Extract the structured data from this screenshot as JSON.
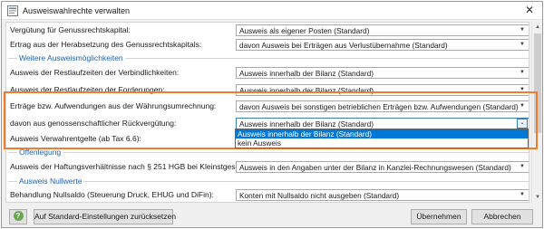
{
  "window": {
    "title": "Ausweiswahlrechte verwalten",
    "close_label": "✕"
  },
  "rows": [
    {
      "label": "Vergütung für Genussrechtskapital:",
      "value": "Ausweis als eigener Posten (Standard)"
    },
    {
      "label": "Ertrag aus der Herabsetzung des Genussrechtskapitals:",
      "value": "davon Ausweis bei Erträgen aus Verlustübernahme (Standard)"
    },
    {
      "label": "Ausweis der Restlaufzeiten der Verbindlichkeiten:",
      "value": "Ausweis innerhalb der Bilanz (Standard)"
    },
    {
      "label": "Ausweis der Restlaufzeiten der Forderungen:",
      "value": "Ausweis innerhalb der Bilanz (Standard)"
    },
    {
      "label": "Erträge bzw. Aufwendungen aus der Währungsumrechnung:",
      "value": "davon Ausweis bei sonstigen betrieblichen Erträgen bzw. Aufwendungen (Standard)"
    },
    {
      "label": "davon aus genossenschaftlicher Rückvergütung:",
      "value": "Ausweis innerhalb der Bilanz (Standard)"
    },
    {
      "label": "Ausweis Verwahrentgelte (ab Tax 6.6):",
      "value": ""
    },
    {
      "label": "Ausweis der Haftungsverhältnisse nach § 251 HGB bei Kleinstgesellschaften:",
      "value": "Ausweis in den Angaben unter der Bilanz in Kanzlei-Rechnungswesen (Standard)"
    },
    {
      "label": "Behandlung Nullsaldo (Steuerung Druck, EHUG und DiFin):",
      "value": "Konten mit Nullsaldo nicht ausgeben (Standard)"
    }
  ],
  "sections": {
    "weitere": "Weitere Ausweismöglichkeiten",
    "offenlegung": "Offenlegung",
    "nullwerte": "Ausweis Nullwerte"
  },
  "dropdown": {
    "options": [
      "Ausweis innerhalb der Bilanz (Standard)",
      "kein Ausweis"
    ],
    "selected_index": 0
  },
  "footer": {
    "help_label": "?",
    "reset_label": "Auf Standard-Einstellungen zurücksetzen",
    "ok_label": "Übernehmen",
    "cancel_label": "Abbrechen"
  },
  "icons": {
    "combo_arrow": "chevron-down-icon",
    "help": "help-icon",
    "app": "app-icon",
    "close": "close-icon"
  },
  "colors": {
    "highlight": "#ef7d2f",
    "selection": "#0078d7",
    "section_label": "#1f5fa8"
  }
}
